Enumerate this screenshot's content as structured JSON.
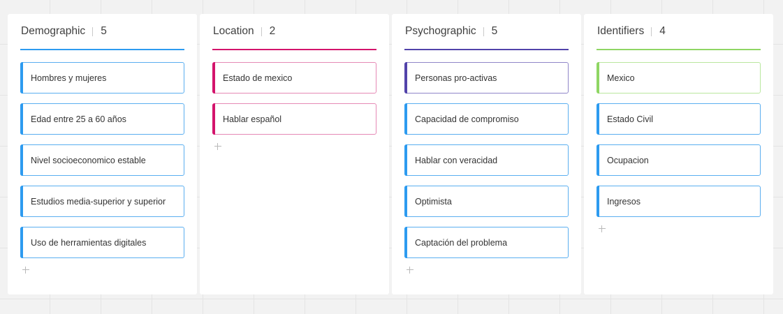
{
  "columns": [
    {
      "title": "Demographic",
      "count": "5",
      "cards": [
        "Hombres y mujeres",
        "Edad entre 25 a 60 años",
        "Nivel socioeconomico estable",
        "Estudios media-superior y superior",
        "Uso de herramientas digitales"
      ],
      "accent": "#2d9bf0"
    },
    {
      "title": "Location",
      "count": "2",
      "cards": [
        "Estado de mexico",
        "Hablar español"
      ],
      "accent": "#d4146c"
    },
    {
      "title": "Psychographic",
      "count": "5",
      "cards": [
        "Personas pro-activas",
        "Capacidad de compromiso",
        "Hablar con veracidad",
        "Optimista",
        "Captación del problema"
      ],
      "accent": "#5243aa"
    },
    {
      "title": "Identifiers",
      "count": "4",
      "cards": [
        "Mexico",
        "Estado Civil",
        "Ocupacion",
        "Ingresos"
      ],
      "accent": "#8fd664"
    }
  ],
  "card_default_accent": "#2d9bf0",
  "add_icon": "plus-icon"
}
